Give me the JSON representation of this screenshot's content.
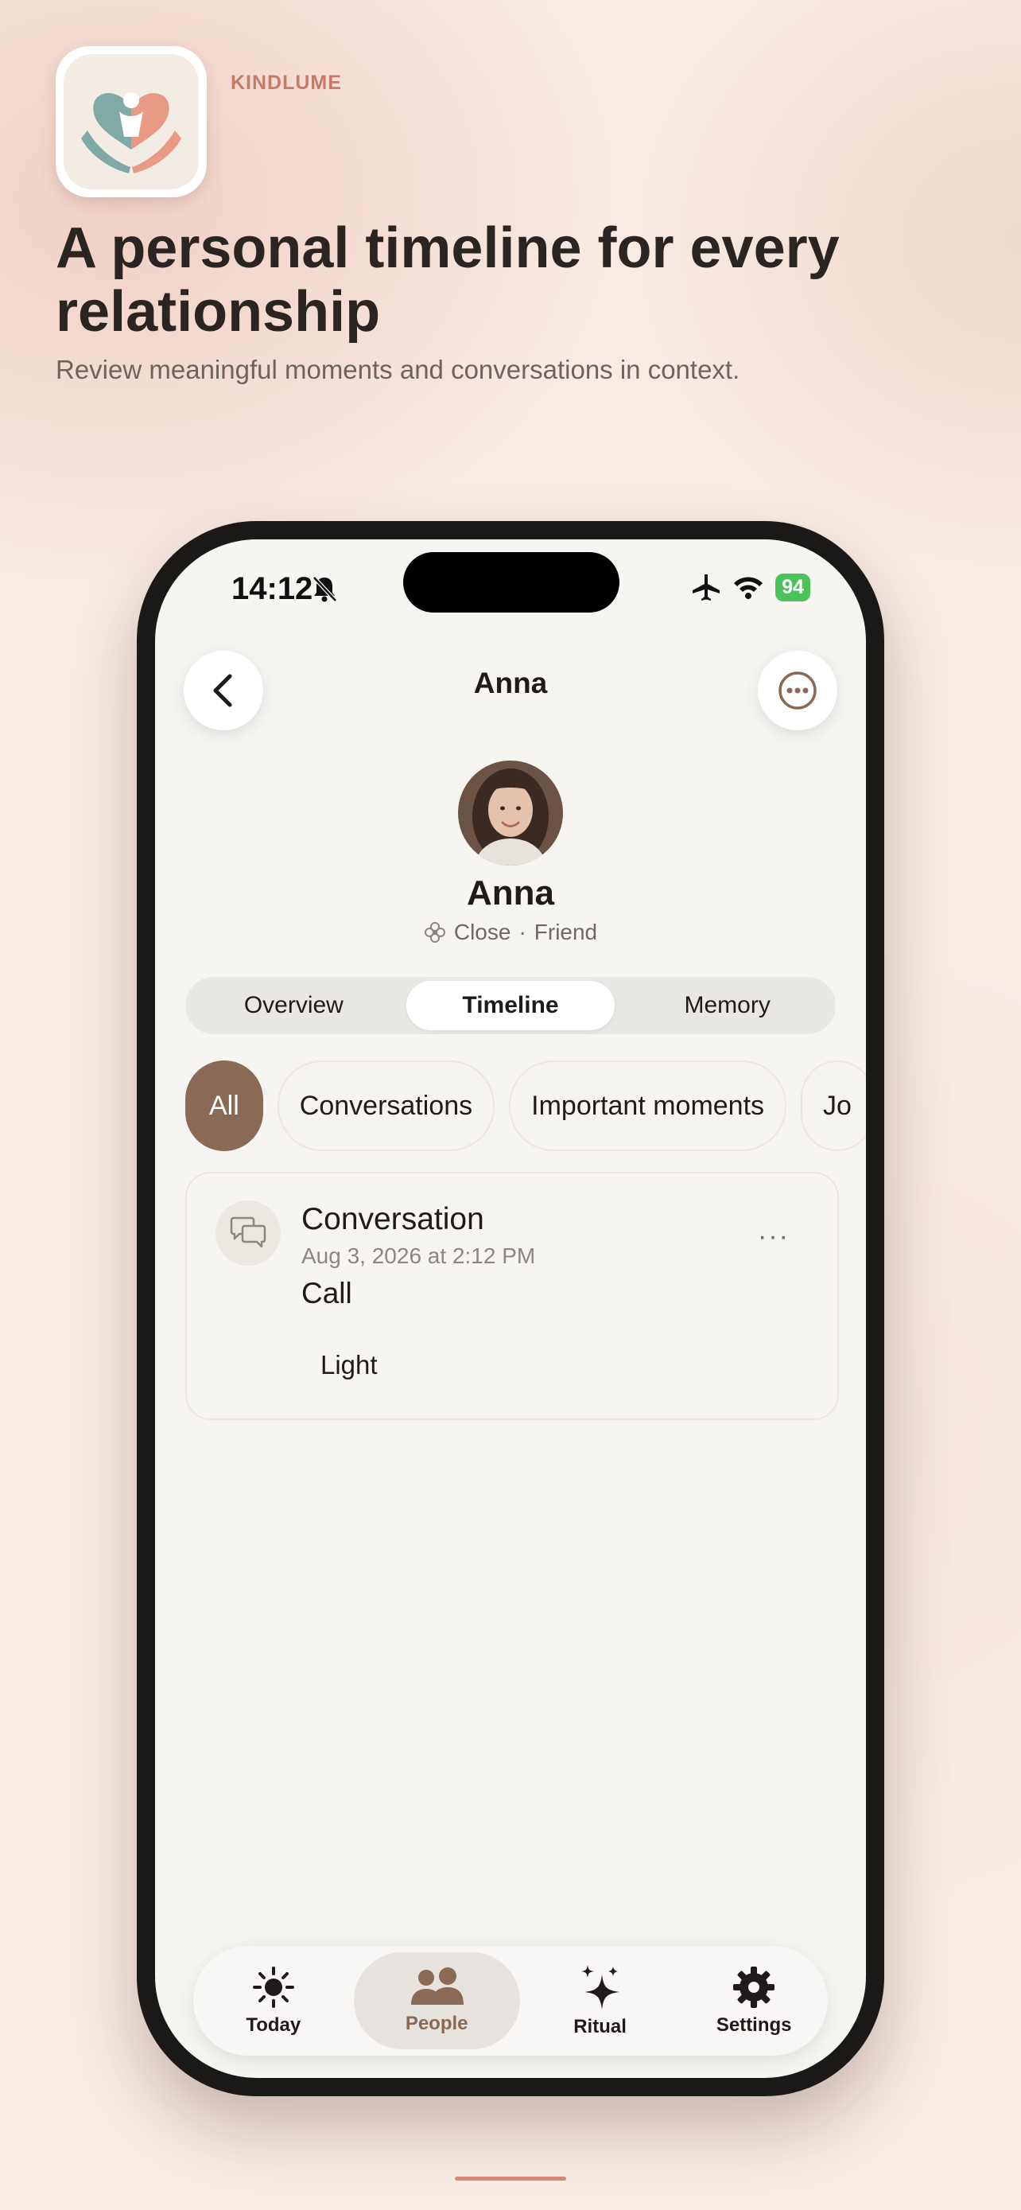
{
  "header": {
    "brand": "KINDLUME",
    "headline": "A personal timeline for every relationship",
    "subhead": "Review meaningful moments and conversations in context."
  },
  "status_bar": {
    "time": "14:12",
    "battery": "94"
  },
  "nav": {
    "title": "Anna"
  },
  "profile": {
    "name": "Anna",
    "closeness": "Close",
    "separator": "·",
    "relation": "Friend"
  },
  "segments": [
    {
      "label": "Overview",
      "active": false
    },
    {
      "label": "Timeline",
      "active": true
    },
    {
      "label": "Memory",
      "active": false
    }
  ],
  "filters": [
    {
      "label": "All",
      "active": true
    },
    {
      "label": "Conversations",
      "active": false
    },
    {
      "label": "Important moments",
      "active": false
    },
    {
      "label": "Jo",
      "active": false
    }
  ],
  "timeline": [
    {
      "title": "Conversation",
      "date": "Aug 3, 2026 at 2:12 PM",
      "type": "Call",
      "tag": "Light",
      "more": "···"
    }
  ],
  "tabs": [
    {
      "label": "Today",
      "icon": "sun-icon"
    },
    {
      "label": "People",
      "icon": "people-icon",
      "active": true
    },
    {
      "label": "Ritual",
      "icon": "sparkle-icon"
    },
    {
      "label": "Settings",
      "icon": "gear-icon"
    }
  ],
  "colors": {
    "accent": "#8a6a55",
    "brand": "#c57b68",
    "battery": "#4cc35a"
  }
}
